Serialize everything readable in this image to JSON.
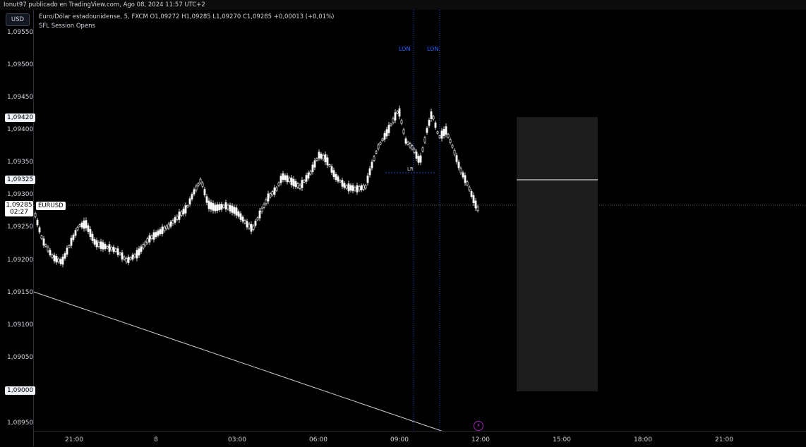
{
  "header": {
    "publish_line": "Ionut97 publicado en TradingView.com, Ago 08, 2024 11:57 UTC+2"
  },
  "legend": {
    "symbol": "Euro/Dólar estadounidense, 5, FXCM",
    "o_label": "O",
    "o_value": "1,09272",
    "h_label": "H",
    "h_value": "1,09285",
    "l_label": "L",
    "l_value": "1,09270",
    "c_label": "C",
    "c_value": "1,09285",
    "change": "+0,00013 (+0,01%)",
    "indicator": "SFL Session Opens"
  },
  "price_axis": {
    "currency": "USD",
    "ticks": [
      "1,09550",
      "1,09500",
      "1,09450",
      "1,09400",
      "1,09350",
      "1,09300",
      "1,09250",
      "1,09200",
      "1,09150",
      "1,09100",
      "1,09050",
      "1,08950"
    ],
    "highlight_high": "1,09420",
    "highlight_mid": "1,09325",
    "highlight_low": "1,09000",
    "current_price": "1,09285",
    "countdown": "02:27",
    "symbol_tag": "EURUSD"
  },
  "time_axis": {
    "ticks": [
      "21:00",
      "8",
      "03:00",
      "06:00",
      "09:00",
      "12:00",
      "15:00",
      "18:00",
      "21:00"
    ]
  },
  "annotations": {
    "session_label_1": "LON",
    "session_label_2": "LON",
    "range_label": "LR"
  },
  "colors": {
    "background": "#000000",
    "session_line": "#2962ff",
    "candle": "#ffffff",
    "box_fill": "#1c1c1c",
    "alert": "#e040fb"
  },
  "icons": {
    "alert": "lightning-icon"
  }
}
